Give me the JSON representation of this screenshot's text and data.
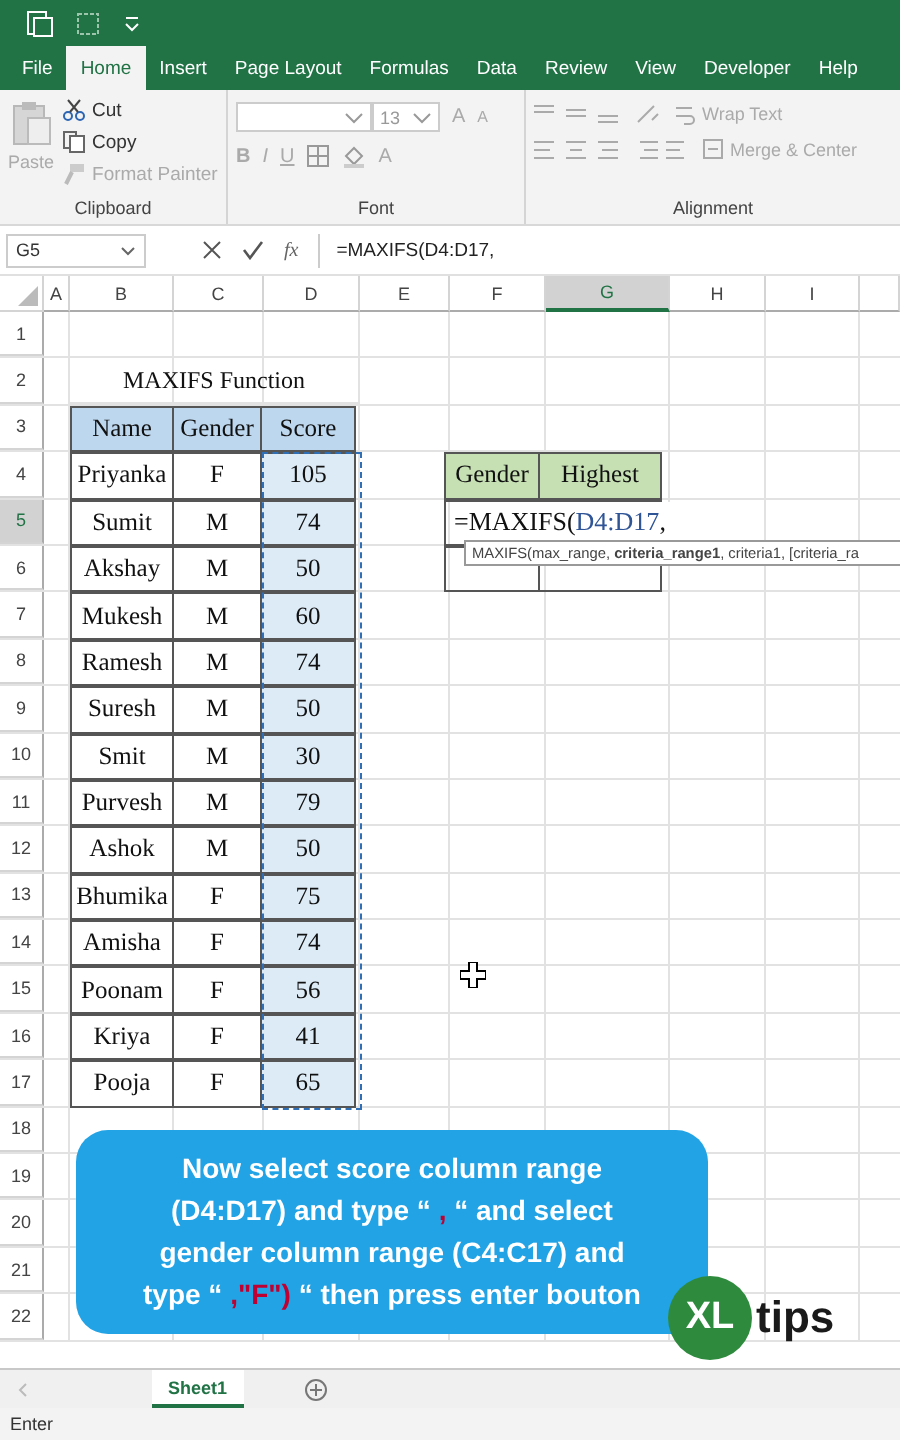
{
  "ribbon_tabs": [
    {
      "label": "File",
      "selected": false
    },
    {
      "label": "Home",
      "selected": true
    },
    {
      "label": "Insert",
      "selected": false
    },
    {
      "label": "Page Layout",
      "selected": false
    },
    {
      "label": "Formulas",
      "selected": false
    },
    {
      "label": "Data",
      "selected": false
    },
    {
      "label": "Review",
      "selected": false
    },
    {
      "label": "View",
      "selected": false
    },
    {
      "label": "Developer",
      "selected": false
    },
    {
      "label": "Help",
      "selected": false
    }
  ],
  "clipboard": {
    "group": "Clipboard",
    "paste": {
      "label": "Paste",
      "disabled": true
    },
    "items": [
      {
        "label": "Cut",
        "kind": "cut",
        "disabled": false
      },
      {
        "label": "Copy",
        "kind": "copy",
        "disabled": false
      },
      {
        "label": "Format Painter",
        "kind": "painter",
        "disabled": true
      }
    ]
  },
  "font": {
    "group": "Font",
    "disabled": true,
    "size": "13",
    "grow": "A",
    "shrink": "A",
    "format_buttons": [
      {
        "label": "B",
        "kind": "bold"
      },
      {
        "label": "I",
        "kind": "italic"
      },
      {
        "label": "U",
        "kind": "underline"
      }
    ],
    "font_color": "A"
  },
  "alignment": {
    "group": "Alignment",
    "disabled": true,
    "wrap_text": "Wrap Text",
    "merge": "Merge & Center"
  },
  "formula_bar": {
    "name_box": "G5",
    "fx": "fx",
    "formula": "=MAXIFS(D4:D17,"
  },
  "columns": [
    {
      "label": "A",
      "selected": false
    },
    {
      "label": "B",
      "selected": false
    },
    {
      "label": "C",
      "selected": false
    },
    {
      "label": "D",
      "selected": false
    },
    {
      "label": "E",
      "selected": false
    },
    {
      "label": "F",
      "selected": false
    },
    {
      "label": "G",
      "selected": true
    },
    {
      "label": "H",
      "selected": false
    },
    {
      "label": "I",
      "selected": false
    }
  ],
  "rows": [
    {
      "label": "1",
      "selected": false
    },
    {
      "label": "2",
      "selected": false
    },
    {
      "label": "3",
      "selected": false
    },
    {
      "label": "4",
      "selected": false
    },
    {
      "label": "5",
      "selected": true
    },
    {
      "label": "6",
      "selected": false
    },
    {
      "label": "7",
      "selected": false
    },
    {
      "label": "8",
      "selected": false
    },
    {
      "label": "9",
      "selected": false
    },
    {
      "label": "10",
      "selected": false
    },
    {
      "label": "11",
      "selected": false
    },
    {
      "label": "12",
      "selected": false
    },
    {
      "label": "13",
      "selected": false
    },
    {
      "label": "14",
      "selected": false
    },
    {
      "label": "15",
      "selected": false
    },
    {
      "label": "16",
      "selected": false
    },
    {
      "label": "17",
      "selected": false
    },
    {
      "label": "18",
      "selected": false
    },
    {
      "label": "19",
      "selected": false
    },
    {
      "label": "20",
      "selected": false
    },
    {
      "label": "21",
      "selected": false
    },
    {
      "label": "22",
      "selected": false
    }
  ],
  "table": {
    "title": "MAXIFS Function",
    "headers": [
      "Name",
      "Gender",
      "Score"
    ],
    "rows": [
      [
        "Priyanka",
        "F",
        "105"
      ],
      [
        "Sumit",
        "M",
        "74"
      ],
      [
        "Akshay",
        "M",
        "50"
      ],
      [
        "Mukesh",
        "M",
        "60"
      ],
      [
        "Ramesh",
        "M",
        "74"
      ],
      [
        "Suresh",
        "M",
        "50"
      ],
      [
        "Smit",
        "M",
        "30"
      ],
      [
        "Purvesh",
        "M",
        "79"
      ],
      [
        "Ashok",
        "M",
        "50"
      ],
      [
        "Bhumika",
        "F",
        "75"
      ],
      [
        "Amisha",
        "F",
        "74"
      ],
      [
        "Poonam",
        "F",
        "56"
      ],
      [
        "Kriya",
        "F",
        "41"
      ],
      [
        "Pooja",
        "F",
        "65"
      ]
    ]
  },
  "summary": {
    "headers": [
      "Gender",
      "Highest"
    ]
  },
  "editing_cell": {
    "function": "=MAXIFS(",
    "reference": "D4:D17",
    "separator": ","
  },
  "tooltip": "MAXIFS(max_range, **criteria_range1**, criteria1, [criteria_ra",
  "callout": {
    "lines": [
      {
        "segments": [
          {
            "text": "Now select score column range",
            "highlight": false
          }
        ]
      },
      {
        "segments": [
          {
            "text": "(D4:D17) and type “ ",
            "highlight": false
          },
          {
            "text": ",",
            "highlight": true
          },
          {
            "text": " “ and select",
            "highlight": false
          }
        ]
      },
      {
        "segments": [
          {
            "text": "gender column range (C4:C17) and",
            "highlight": false
          }
        ]
      },
      {
        "segments": [
          {
            "text": "type “ ",
            "highlight": false
          },
          {
            "text": ",\"F\")",
            "highlight": true
          },
          {
            "text": " “ then press enter bouton",
            "highlight": false
          }
        ]
      }
    ]
  },
  "logo": {
    "badge": "XL",
    "text": "tips"
  },
  "sheet_tabs": [
    {
      "label": "Sheet1",
      "selected": true
    }
  ],
  "status_bar": {
    "mode": "Enter"
  }
}
